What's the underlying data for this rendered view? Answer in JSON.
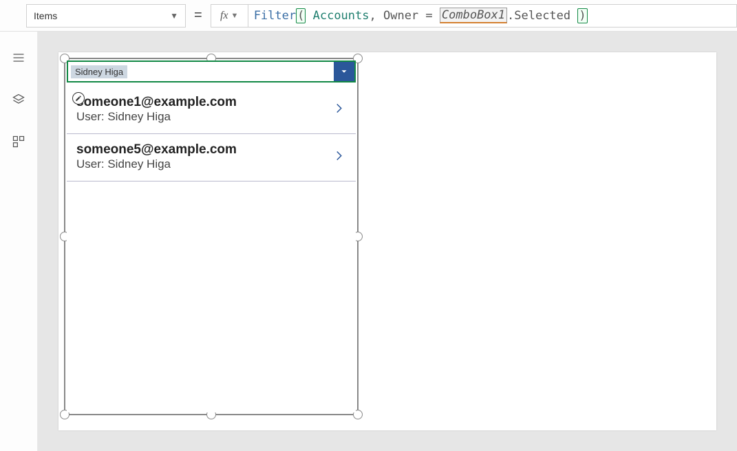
{
  "toolbar": {
    "property_name": "Items",
    "formula_tokens": {
      "func": "Filter",
      "ident": "Accounts",
      "owner": "Owner",
      "combobox": "ComboBox1",
      "selected": ".Selected"
    },
    "equals": "="
  },
  "sidebar": {
    "icons": [
      "hamburger",
      "layers",
      "components"
    ]
  },
  "canvas": {
    "combobox": {
      "selected_label": "Sidney Higa"
    },
    "gallery": [
      {
        "title": "someone1@example.com",
        "subtitle": "User: Sidney Higa"
      },
      {
        "title": "someone5@example.com",
        "subtitle": "User: Sidney Higa"
      }
    ]
  }
}
